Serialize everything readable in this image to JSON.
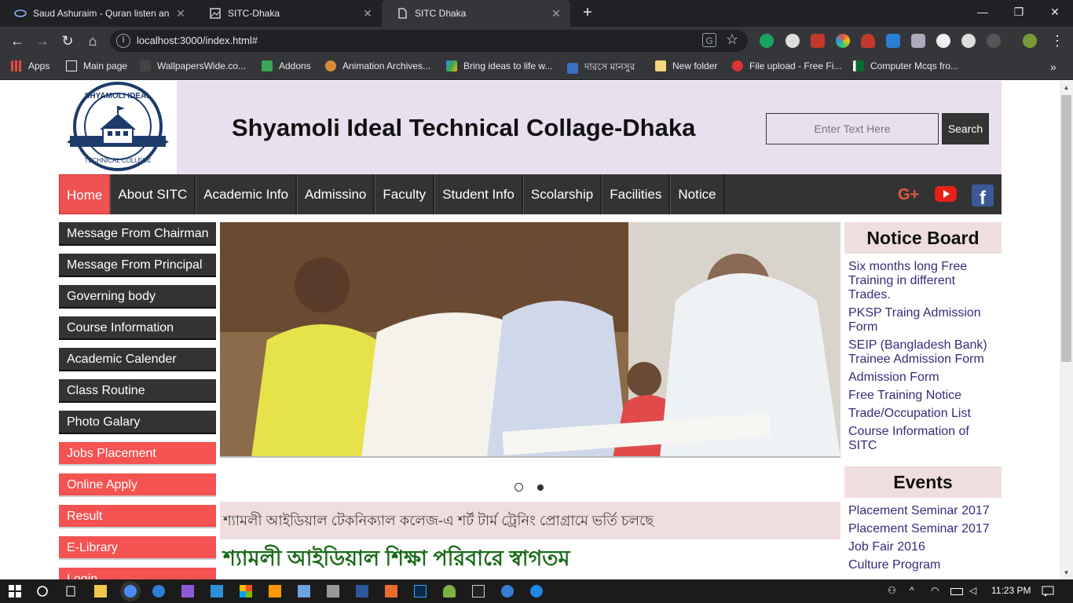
{
  "browser": {
    "tabs": [
      {
        "title": "Saud Ashuraim - Quran listen an",
        "active": false
      },
      {
        "title": "SITC-Dhaka",
        "active": false
      },
      {
        "title": "SITC Dhaka",
        "active": true
      }
    ],
    "url": "localhost:3000/index.html#",
    "bookmarks": [
      "Apps",
      "Main page",
      "WallpapersWide.co...",
      "Addons",
      "Animation Archives...",
      "Bring ideas to life w...",
      "দারসে মানসুর",
      "New folder",
      "File upload - Free Fi...",
      "Computer Mcqs fro..."
    ]
  },
  "header": {
    "title": "Shyamoli Ideal Technical Collage-Dhaka",
    "logo_text": "SHYAMOLI IDEAL TECHNICAL COLLEGE",
    "search_placeholder": "Enter Text Here",
    "search_button": "Search"
  },
  "nav": [
    "Home",
    "About SITC",
    "Academic Info",
    "Admissino",
    "Faculty",
    "Student Info",
    "Scolarship",
    "Facilities",
    "Notice"
  ],
  "sidebar": [
    {
      "label": "Message From Chairman",
      "style": "dark"
    },
    {
      "label": "Message From Principal",
      "style": "dark"
    },
    {
      "label": "Governing body",
      "style": "dark"
    },
    {
      "label": "Course Information",
      "style": "dark"
    },
    {
      "label": "Academic Calender",
      "style": "dark"
    },
    {
      "label": "Class Routine",
      "style": "dark"
    },
    {
      "label": "Photo Galary",
      "style": "dark"
    },
    {
      "label": "Jobs Placement",
      "style": "red"
    },
    {
      "label": "Online Apply",
      "style": "red"
    },
    {
      "label": "Result",
      "style": "red"
    },
    {
      "label": "E-Library",
      "style": "red"
    },
    {
      "label": "Login",
      "style": "red"
    }
  ],
  "marquee": "শ্যামলী আইডিয়াল টেকনিক্যাল কলেজ-এ শর্ট টার্ম ট্রেনিং প্রোগ্রামে ভর্তি চলছে",
  "welcome": "শ্যামলী আইডিয়াল শিক্ষা পরিবারে স্বাগতম",
  "notice_board": {
    "title": "Notice Board",
    "items": [
      "Six months long Free Training in different Trades.",
      "PKSP Traing Admission Form",
      "SEIP (Bangladesh Bank) Trainee Admission Form",
      "Admission Form",
      "Free Training Notice",
      "Trade/Occupation List",
      "Course Information of SITC"
    ]
  },
  "events": {
    "title": "Events",
    "items": [
      "Placement Seminar 2017",
      "Placement Seminar 2017",
      "Job Fair 2016",
      "Culture Program"
    ]
  },
  "taskbar": {
    "time": "11:23 PM"
  },
  "colors": {
    "accent_red": "#f05252",
    "dark": "#333333",
    "header_bg": "#e8e0ee",
    "box_bg": "#f0dedf",
    "welcome_green": "#1a6b1a"
  }
}
